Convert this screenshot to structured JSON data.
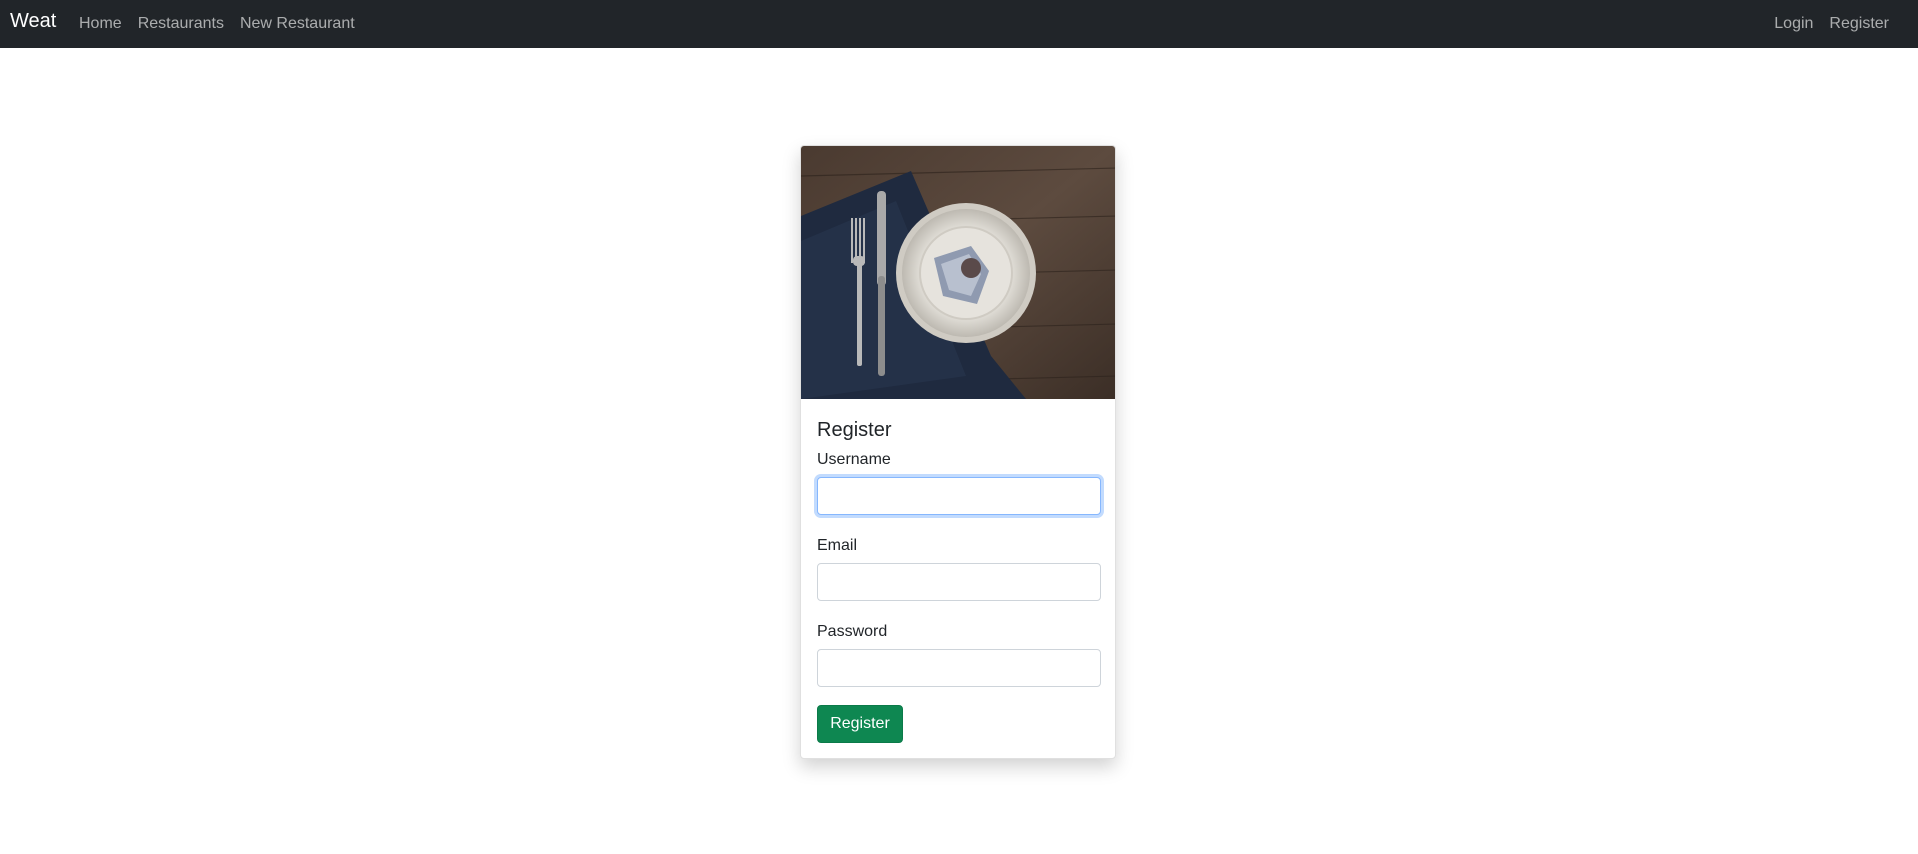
{
  "navbar": {
    "brand": "Weat",
    "left_links": [
      "Home",
      "Restaurants",
      "New Restaurant"
    ],
    "right_links": [
      "Login",
      "Register"
    ]
  },
  "card": {
    "image_subject": "place-setting-photo",
    "title": "Register",
    "fields": {
      "username": {
        "label": "Username",
        "value": ""
      },
      "email": {
        "label": "Email",
        "value": ""
      },
      "password": {
        "label": "Password",
        "value": ""
      }
    },
    "submit_label": "Register"
  },
  "colors": {
    "navbar_bg": "#212529",
    "button_bg": "#0e8751",
    "focus_border": "#86b7fe"
  }
}
